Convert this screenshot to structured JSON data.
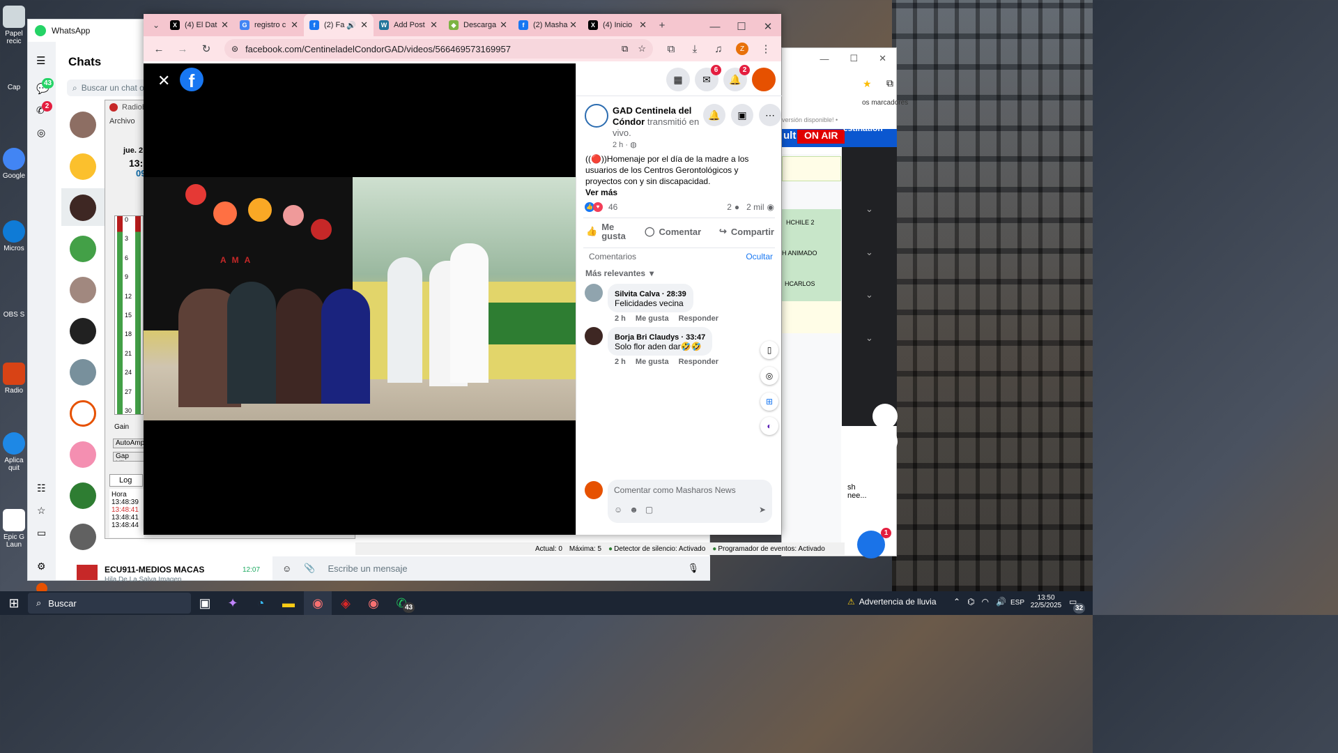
{
  "desktop": {
    "icons": [
      {
        "label": "Papel recic"
      },
      {
        "label": "Cap"
      },
      {
        "label": "Google"
      },
      {
        "label": "Micros"
      },
      {
        "label": "OBS S"
      },
      {
        "label": "Radio"
      },
      {
        "label": "Aplica quit"
      },
      {
        "label": "Epic G Laun"
      }
    ]
  },
  "whatsapp": {
    "title": "WhatsApp",
    "chats_heading": "Chats",
    "search_placeholder": "Buscar un chat o",
    "chats_badge": "43",
    "calls_badge": "2",
    "last_chat": {
      "name": "ECU911-MEDIOS MACAS",
      "time": "12:07",
      "preview": "Hila De La Salva   Imagen"
    },
    "compose_placeholder": "Escribe un mensaje"
  },
  "radioboss": {
    "title": "RadioBC",
    "menu": "Archivo",
    "date": "jue. 2:",
    "time": "13:",
    "time2": "09",
    "meter_ticks": [
      "0",
      "3",
      "6",
      "9",
      "12",
      "15",
      "18",
      "21",
      "24",
      "27",
      "30"
    ],
    "gain": "Gain",
    "autoamp": "AutoAmp",
    "gapkiller": "Gap killer",
    "log_tab": "Log",
    "log_header": "Hora",
    "log": [
      "13:48:39",
      "13:48:41",
      "13:48:41",
      "13:48:44"
    ]
  },
  "status": {
    "actual": "Actual: 0",
    "maxima": "Máxima: 5",
    "silence": "Detector de silencio: Activado",
    "scheduler": "Programador de eventos: Activado"
  },
  "right_panel": {
    "bookmarks": "os marcadores",
    "version": "versión disponible! •",
    "ult": "ult",
    "onair": "ON AIR",
    "destination": "estination",
    "rows": [
      "HCHILE 2",
      "H ANIMADO",
      "HCARLOS"
    ],
    "chat_snip": "sh",
    "chat_snip2": "nee..."
  },
  "chrome": {
    "tabs": [
      {
        "title": "(4) El Dat",
        "fav": "X",
        "color": "#000"
      },
      {
        "title": "registro c",
        "fav": "G",
        "color": "#4285f4"
      },
      {
        "title": "(2) Fa",
        "fav": "f",
        "color": "#1877f2",
        "active": true
      },
      {
        "title": "Add Post",
        "fav": "W",
        "color": "#21759b"
      },
      {
        "title": "Descarga",
        "fav": "◆",
        "color": "#7cb342"
      },
      {
        "title": "(2) Masha",
        "fav": "f",
        "color": "#1877f2"
      },
      {
        "title": "(4) Inicio",
        "fav": "X",
        "color": "#000"
      }
    ],
    "url": "facebook.com/CentineladelCondorGAD/videos/566469573169957",
    "profile_letter": "Z"
  },
  "facebook": {
    "messenger_badge": "6",
    "notif_badge": "2",
    "page_name": "GAD Centinela del Cóndor",
    "action": " transmitió en vivo.",
    "time": "2 h · ",
    "text": "((🔴))Homenaje por el día de la madre a los usuarios de los Centros Gerontológicos y proyectos con y sin discapacidad.",
    "see_more": "Ver más",
    "reactions": "46",
    "comments_count": "2",
    "views": "2 mil",
    "like": "Me gusta",
    "comment": "Comentar",
    "share": "Compartir",
    "comments_label": "Comentarios",
    "hide": "Ocultar",
    "relevant": "Más relevantes",
    "comments": [
      {
        "name": "Silvita Calva",
        "stamp": " · 28:39",
        "text": "Felicidades vecina",
        "time": "2 h",
        "like": "Me gusta",
        "reply": "Responder"
      },
      {
        "name": "Borja Bri Claudys",
        "stamp": " · 33:47",
        "text": "Solo flor aden dar🤣🤣",
        "time": "2 h",
        "like": "Me gusta",
        "reply": "Responder"
      }
    ],
    "compose_placeholder": "Comentar como Masharos News",
    "video_banner": [
      "A",
      "M",
      "A"
    ]
  },
  "taskbar": {
    "search": "Buscar",
    "weather": "Advertencia de lluvia",
    "lang": "ESP",
    "time": "13:50",
    "date": "22/5/2025",
    "notif": "32",
    "wa_badge": "43"
  }
}
